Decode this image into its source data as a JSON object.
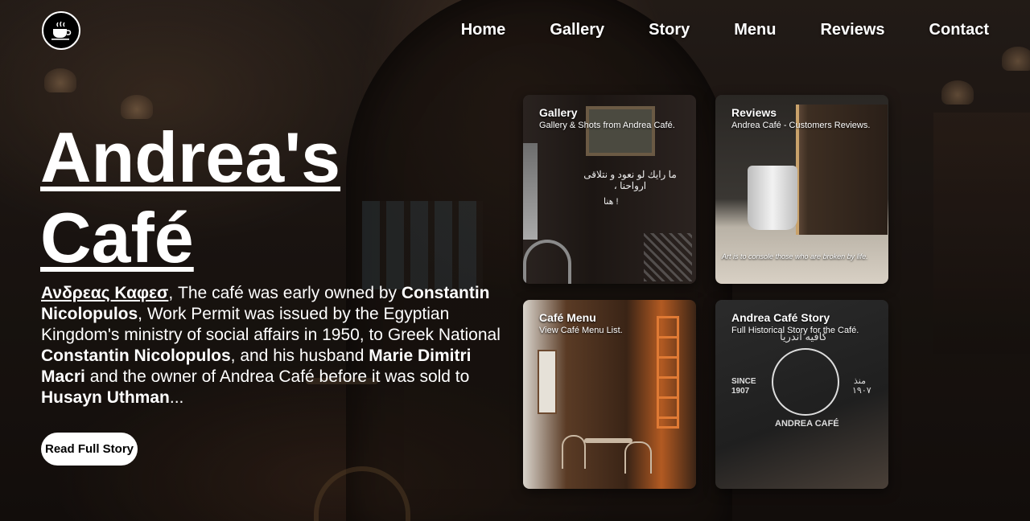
{
  "header": {
    "logo_icon": "coffee-cup-icon",
    "nav": [
      {
        "label": "Home"
      },
      {
        "label": "Gallery"
      },
      {
        "label": "Story"
      },
      {
        "label": "Menu"
      },
      {
        "label": "Reviews"
      },
      {
        "label": "Contact"
      }
    ]
  },
  "hero": {
    "title": "Andrea's Café",
    "intro": {
      "greek_name": "Ανδρεας Καφεσ",
      "t1": ", The café was early owned by ",
      "b1": "Constantin Nicolopulos",
      "t2": ", Work Permit was issued by the Egyptian Kingdom's ministry of social affairs in 1950, to Greek National ",
      "b2": "Constantin Nicolopulos",
      "t3": ", and his husband ",
      "b3": "Marie Dimitri Macri",
      "t4": " and the owner of Andrea Café before it was sold to ",
      "b4": "Husayn Uthman",
      "t5": "..."
    },
    "cta_label": "Read Full Story"
  },
  "cards": {
    "gallery": {
      "title": "Gallery",
      "subtitle": "Gallery & Shots from Andrea Café.",
      "image_text": "ما رايك لو نعود و نتلاقى ارواحنا ،",
      "image_text2": "هنا !"
    },
    "reviews": {
      "title": "Reviews",
      "subtitle": "Andrea Café - Customers Reviews.",
      "quote": "Art is to console those who are broken by life."
    },
    "menu": {
      "title": "Café Menu",
      "subtitle": "View Café Menu List."
    },
    "story": {
      "title": "Andrea Café Story",
      "subtitle": "Full Historical Story for the Café.",
      "since": "SINCE",
      "year": "1907",
      "brand": "ANDREA CAFÉ",
      "arabic_name": "كافيه اندريا",
      "arabic_since": "منذ",
      "arabic_year": "١٩٠٧"
    }
  },
  "colors": {
    "accent": "#ffffff",
    "dark": "#1f1814"
  }
}
